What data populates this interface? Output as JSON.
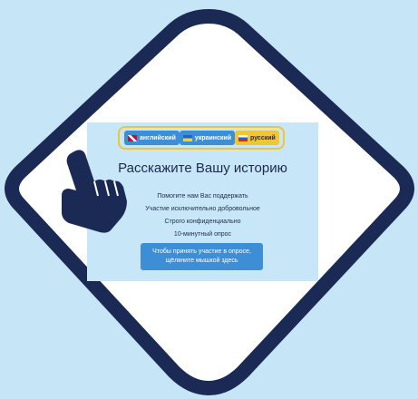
{
  "languages": [
    {
      "label": "английский",
      "flag": "uk-flag-icon",
      "style": "blue"
    },
    {
      "label": "украинский",
      "flag": "ukraine-flag-icon",
      "style": "blue"
    },
    {
      "label": "русский",
      "flag": "russia-flag-icon",
      "style": "yellow"
    }
  ],
  "main": {
    "title": "Расскажите Вашу историю",
    "lines": [
      "Помогите нам Вас поддержать",
      "Участие исключительно добровольное",
      "Строго конфиденциально",
      "10-минутный опрос"
    ],
    "cta_line1": "Чтобы принять участие в опросе,",
    "cta_line2": "щёлкните мышкой здесь"
  },
  "colors": {
    "background": "#c6e5f6",
    "diamond_border": "#1b2a55",
    "diamond_fill": "#ffffff",
    "panel": "#c7e6f7",
    "accent_blue": "#3e8ed6",
    "accent_yellow": "#f2c535",
    "text_dark": "#1e2a4d"
  },
  "icons": {
    "pointer": "pointing-hand-icon"
  }
}
